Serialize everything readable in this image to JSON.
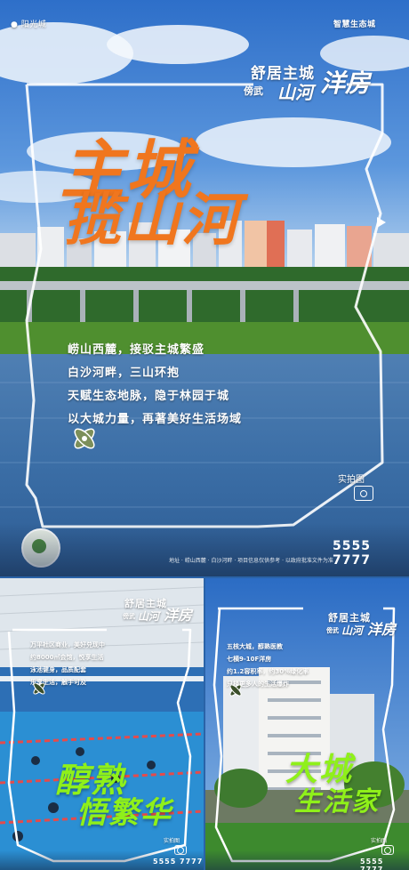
{
  "main": {
    "logo_left": "● 阳光城",
    "logo_right": "智慧生态城",
    "tagline_top": "舒居主城",
    "tagline_mid": "山河",
    "tagline_brand": "洋房",
    "tagline_prefix": "傍武",
    "headline_line1": "主城",
    "headline_line2": "揽山河",
    "body_lines": [
      "崂山西麓，接驳主城繁盛",
      "白沙河畔，三山环抱",
      "天赋生态地脉，隐于林园于城",
      "以大城力量，再著美好生活场域"
    ],
    "photo_caption": "实拍图",
    "phone": "5555 7777",
    "footer_fine_print": "地址 · 崂山西麓 · 白沙河畔 · 项目信息仅供参考 · 以政府批准文件为准"
  },
  "left": {
    "tagline_top": "舒居主城",
    "tagline_mid": "山河",
    "tagline_brand": "洋房",
    "tagline_prefix": "傍武",
    "body_lines": [
      "万平社区商业，美好兑现中",
      "约8000㎡会馆，悦享生活",
      "泳池健身，品质配套",
      "乐享生活，触手可及"
    ],
    "headline_line1": "醇熟",
    "headline_line2": "悟繁华",
    "photo_caption": "实拍图",
    "phone": "5555 7777"
  },
  "right": {
    "tagline_top": "舒居主城",
    "tagline_mid": "山河",
    "tagline_brand": "洋房",
    "tagline_prefix": "傍武",
    "body_lines": [
      "五核大城，醇熟医教",
      "七横9-10F洋房",
      "约1.2容积率，约30%绿化率",
      "只择更多人的生活爆炸"
    ],
    "headline_line1": "大城",
    "headline_line2": "生活家",
    "photo_caption": "实拍图",
    "phone": "5555 7777"
  },
  "colors": {
    "headline_orange": "#f0761e",
    "headline_green": "#8ff01a",
    "frame_white": "#ffffff",
    "sky": "#3a7bd5",
    "water": "#3d6fa8",
    "grass": "#4a8a2a"
  }
}
